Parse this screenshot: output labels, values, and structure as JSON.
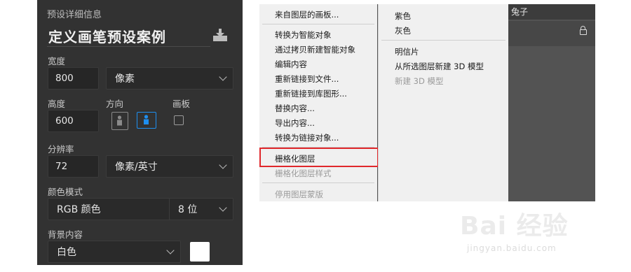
{
  "preset_panel": {
    "section_title": "预设详细信息",
    "preset_name": "定义画笔预设案例",
    "width_label": "宽度",
    "width_value": "800",
    "width_unit": "像素",
    "height_label": "高度",
    "height_value": "600",
    "orientation_label": "方向",
    "artboard_label": "画板",
    "resolution_label": "分辨率",
    "resolution_value": "72",
    "resolution_unit": "像素/英寸",
    "color_mode_label": "颜色模式",
    "color_mode_value": "RGB 颜色",
    "bit_depth_value": "8 位",
    "background_label": "背景内容",
    "background_value": "白色",
    "background_swatch_color": "#ffffff",
    "accent_color": "#1e8ff0"
  },
  "context_menu": {
    "items": [
      {
        "label": "来自图层的画板...",
        "disabled": false
      },
      {
        "label": "转换为智能对象",
        "disabled": false
      },
      {
        "label": "通过拷贝新建智能对象",
        "disabled": false
      },
      {
        "label": "编辑内容",
        "disabled": false
      },
      {
        "label": "重新链接到文件...",
        "disabled": false
      },
      {
        "label": "重新链接到库图形...",
        "disabled": false
      },
      {
        "label": "替换内容...",
        "disabled": false
      },
      {
        "label": "导出内容...",
        "disabled": false
      },
      {
        "label": "转换为链接对象...",
        "disabled": false
      },
      {
        "label": "栅格化图层",
        "disabled": false,
        "highlighted": true
      },
      {
        "label": "栅格化图层样式",
        "disabled": true
      },
      {
        "label": "停用图层蒙版",
        "disabled": true
      }
    ],
    "highlight_color": "#e0272b"
  },
  "submenu": {
    "items": [
      {
        "label": "紫色",
        "disabled": false
      },
      {
        "label": "灰色",
        "disabled": false
      },
      {
        "label": "明信片",
        "disabled": false
      },
      {
        "label": "从所选图层新建 3D 模型",
        "disabled": false
      },
      {
        "label": "新建 3D 模型",
        "disabled": true
      }
    ]
  },
  "layers_panel": {
    "layer_name": "兔子"
  },
  "watermark": {
    "brand": "Bai 经验",
    "url": "jingyan.baidu.com"
  }
}
